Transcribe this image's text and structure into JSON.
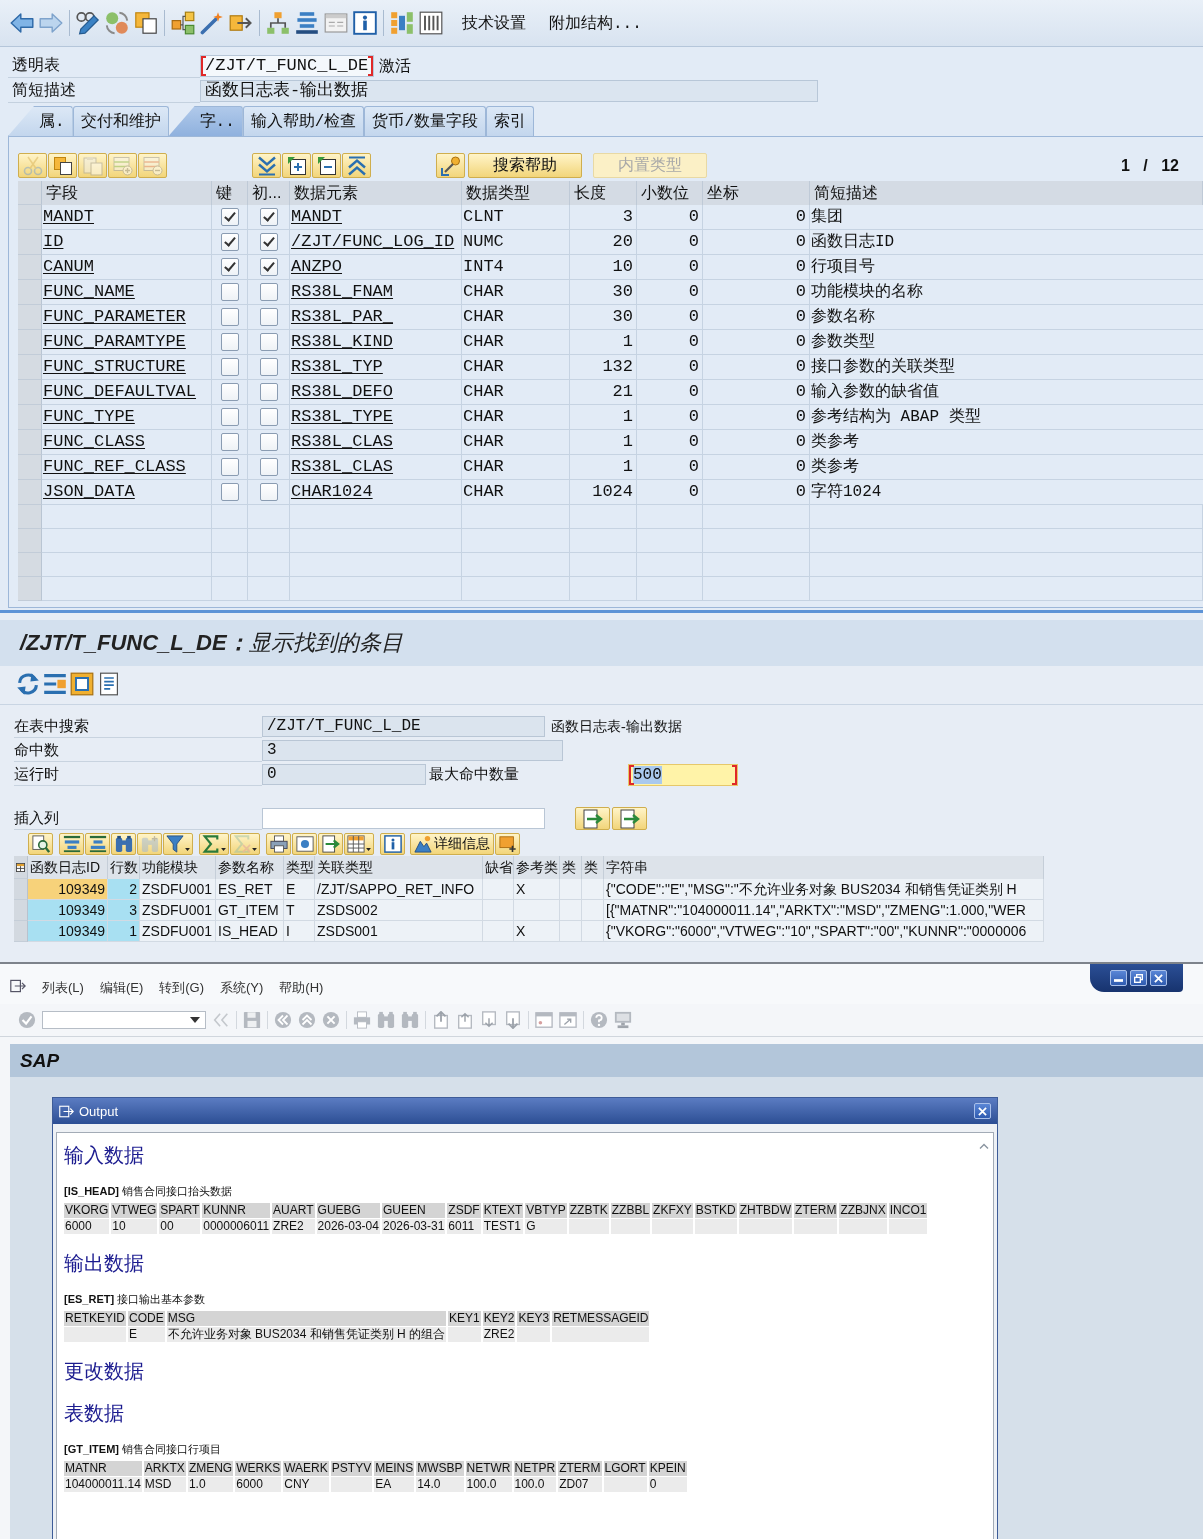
{
  "definition_window": {
    "toolbar": {
      "text_buttons": [
        "技术设置",
        "附加结构..."
      ]
    },
    "header_fields": [
      {
        "label": "透明表",
        "value": "/ZJT/T_FUNC_L_DE",
        "focused": true,
        "status": "激活"
      },
      {
        "label": "简短描述",
        "value": "函数日志表-输出数据",
        "focused": false
      }
    ],
    "tabs": [
      {
        "label": "属.",
        "selected": false
      },
      {
        "label": "交付和维护",
        "selected": false
      },
      {
        "label": "字..",
        "selected": true
      },
      {
        "label": "输入帮助/检查",
        "selected": false
      },
      {
        "label": "货币/数量字段",
        "selected": false
      },
      {
        "label": "索引",
        "selected": false
      }
    ],
    "table_toolbar": {
      "buttons": [
        {
          "label": "搜索帮助",
          "disabled": false
        },
        {
          "label": "内置类型",
          "disabled": true
        }
      ],
      "page_counter": "1 / 12"
    },
    "fields_table": {
      "columns": [
        "字段",
        "键",
        "初...",
        "数据元素",
        "数据类型",
        "长度",
        "小数位",
        "坐标",
        "简短描述"
      ],
      "rows": [
        {
          "field": "MANDT",
          "key": true,
          "initial": true,
          "data_element": "MANDT",
          "data_type": "CLNT",
          "length": "3",
          "decimals": "0",
          "coordinate": "0",
          "description": "集团"
        },
        {
          "field": "ID",
          "key": true,
          "initial": true,
          "data_element": "/ZJT/FUNC_LOG_ID",
          "data_type": "NUMC",
          "length": "20",
          "decimals": "0",
          "coordinate": "0",
          "description": "函数日志ID"
        },
        {
          "field": "CANUM",
          "key": true,
          "initial": true,
          "data_element": "ANZPO",
          "data_type": "INT4",
          "length": "10",
          "decimals": "0",
          "coordinate": "0",
          "description": "行项目号"
        },
        {
          "field": "FUNC_NAME",
          "key": false,
          "initial": false,
          "data_element": "RS38L_FNAM",
          "data_type": "CHAR",
          "length": "30",
          "decimals": "0",
          "coordinate": "0",
          "description": "功能模块的名称"
        },
        {
          "field": "FUNC_PARAMETER",
          "key": false,
          "initial": false,
          "data_element": "RS38L_PAR_",
          "data_type": "CHAR",
          "length": "30",
          "decimals": "0",
          "coordinate": "0",
          "description": "参数名称"
        },
        {
          "field": "FUNC_PARAMTYPE",
          "key": false,
          "initial": false,
          "data_element": "RS38L_KIND",
          "data_type": "CHAR",
          "length": "1",
          "decimals": "0",
          "coordinate": "0",
          "description": "参数类型"
        },
        {
          "field": "FUNC_STRUCTURE",
          "key": false,
          "initial": false,
          "data_element": "RS38L_TYP",
          "data_type": "CHAR",
          "length": "132",
          "decimals": "0",
          "coordinate": "0",
          "description": "接口参数的关联类型"
        },
        {
          "field": "FUNC_DEFAULTVAL",
          "key": false,
          "initial": false,
          "data_element": "RS38L_DEFO",
          "data_type": "CHAR",
          "length": "21",
          "decimals": "0",
          "coordinate": "0",
          "description": "输入参数的缺省值"
        },
        {
          "field": "FUNC_TYPE",
          "key": false,
          "initial": false,
          "data_element": "RS38L_TYPE",
          "data_type": "CHAR",
          "length": "1",
          "decimals": "0",
          "coordinate": "0",
          "description": "参考结构为 ABAP 类型"
        },
        {
          "field": "FUNC_CLASS",
          "key": false,
          "initial": false,
          "data_element": "RS38L_CLAS",
          "data_type": "CHAR",
          "length": "1",
          "decimals": "0",
          "coordinate": "0",
          "description": "类参考"
        },
        {
          "field": "FUNC_REF_CLASS",
          "key": false,
          "initial": false,
          "data_element": "RS38L_CLAS",
          "data_type": "CHAR",
          "length": "1",
          "decimals": "0",
          "coordinate": "0",
          "description": "类参考"
        },
        {
          "field": "JSON_DATA",
          "key": false,
          "initial": false,
          "data_element": "CHAR1024",
          "data_type": "CHAR",
          "length": "1024",
          "decimals": "0",
          "coordinate": "0",
          "description": "字符1024"
        }
      ]
    }
  },
  "search_window": {
    "title": "**/ZJT/T_FUNC_L_DE：**显示找到的条目",
    "fields": [
      {
        "label": "在表中搜索",
        "value": "/ZJT/T_FUNC_L_DE",
        "note": "函数日志表-输出数据"
      },
      {
        "label": "命中数",
        "value": "3"
      },
      {
        "label": "运行时",
        "value": "0",
        "extra": {
          "label": "最大命中数量",
          "value": "500",
          "focused": true
        }
      }
    ],
    "insert_column": {
      "label": "插入列"
    },
    "alv_toolbar": {
      "detail_button": "详细信息"
    },
    "results": {
      "columns": [
        "函数日志ID",
        "行数",
        "功能模块",
        "参数名称",
        "类型",
        "关联类型",
        "缺省",
        "参考类",
        "类",
        "类",
        "字符串"
      ],
      "rows": [
        {
          "selected": true,
          "cells": [
            "109349",
            "2",
            "ZSDFU001",
            "ES_RET",
            "E",
            "/ZJT/SAPPO_RET_INFO",
            null,
            "X",
            null,
            null,
            "{\"CODE\":\"E\",\"MSG\":\"不允许业务对象 BUS2034 和销售凭证类别 H"
          ]
        },
        {
          "selected": false,
          "cells": [
            "109349",
            "3",
            "ZSDFU001",
            "GT_ITEM",
            "T",
            "ZSDS002",
            null,
            null,
            null,
            null,
            "[{\"MATNR\":\"104000011.14\",\"ARKTX\":\"MSD\",\"ZMENG\":1.000,\"WER"
          ]
        },
        {
          "selected": false,
          "cells": [
            "109349",
            "1",
            "ZSDFU001",
            "IS_HEAD",
            "I",
            "ZSDS001",
            null,
            "X",
            null,
            null,
            "{\"VKORG\":\"6000\",\"VTWEG\":\"10\",\"SPART\":\"00\",\"KUNNR\":\"0000006"
          ]
        }
      ]
    }
  },
  "sap_window": {
    "menu": [
      "列表(L)",
      "编辑(E)",
      "转到(G)",
      "系统(Y)",
      "帮助(H)"
    ],
    "title": "SAP",
    "dialog": {
      "title": "Output",
      "blocks": [
        {
          "kind": "heading",
          "text": "输入数据"
        },
        {
          "kind": "table",
          "caption": "**[IS_HEAD]** 销售合同接口抬头数据",
          "columns": [
            "VKORG",
            "VTWEG",
            "SPART",
            "KUNNR",
            "AUART",
            "GUEBG",
            "GUEEN",
            "ZSDF",
            "KTEXT",
            "VBTYP",
            "ZZBTK",
            "ZZBBL",
            "ZKFXY",
            "BSTKD",
            "ZHTBDW",
            "ZTERM",
            "ZZBJNX",
            "INCO1"
          ],
          "rows": [
            [
              "6000",
              "10",
              "00",
              "0000006011",
              "ZRE2",
              "2026-03-04",
              "2026-03-31",
              "6011",
              "TEST1",
              "G",
              null,
              null,
              null,
              null,
              null,
              null,
              null,
              null
            ]
          ]
        },
        {
          "kind": "heading",
          "text": "输出数据"
        },
        {
          "kind": "table",
          "caption": "**[ES_RET]** 接口输出基本参数",
          "columns": [
            "RETKEYID",
            "CODE",
            "MSG",
            "KEY1",
            "KEY2",
            "KEY3",
            "RETMESSAGEID"
          ],
          "rows": [
            [
              null,
              "E",
              "不允许业务对象 BUS2034 和销售凭证类别 H 的组合",
              null,
              "ZRE2",
              null,
              null
            ]
          ]
        },
        {
          "kind": "heading",
          "text": "更改数据"
        },
        {
          "kind": "heading",
          "text": "表数据"
        },
        {
          "kind": "table",
          "caption": "**[GT_ITEM]** 销售合同接口行项目",
          "columns": [
            "MATNR",
            "ARKTX",
            "ZMENG",
            "WERKS",
            "WAERK",
            "PSTYV",
            "MEINS",
            "MWSBP",
            "NETWR",
            "NETPR",
            "ZTERM",
            "LGORT",
            "KPEIN"
          ],
          "rows": [
            [
              "104000011.14",
              "MSD",
              "1.0",
              "6000",
              "CNY",
              null,
              "EA",
              "14.0",
              "100.0",
              "100.0",
              "ZD07",
              null,
              "0"
            ]
          ]
        }
      ]
    }
  }
}
